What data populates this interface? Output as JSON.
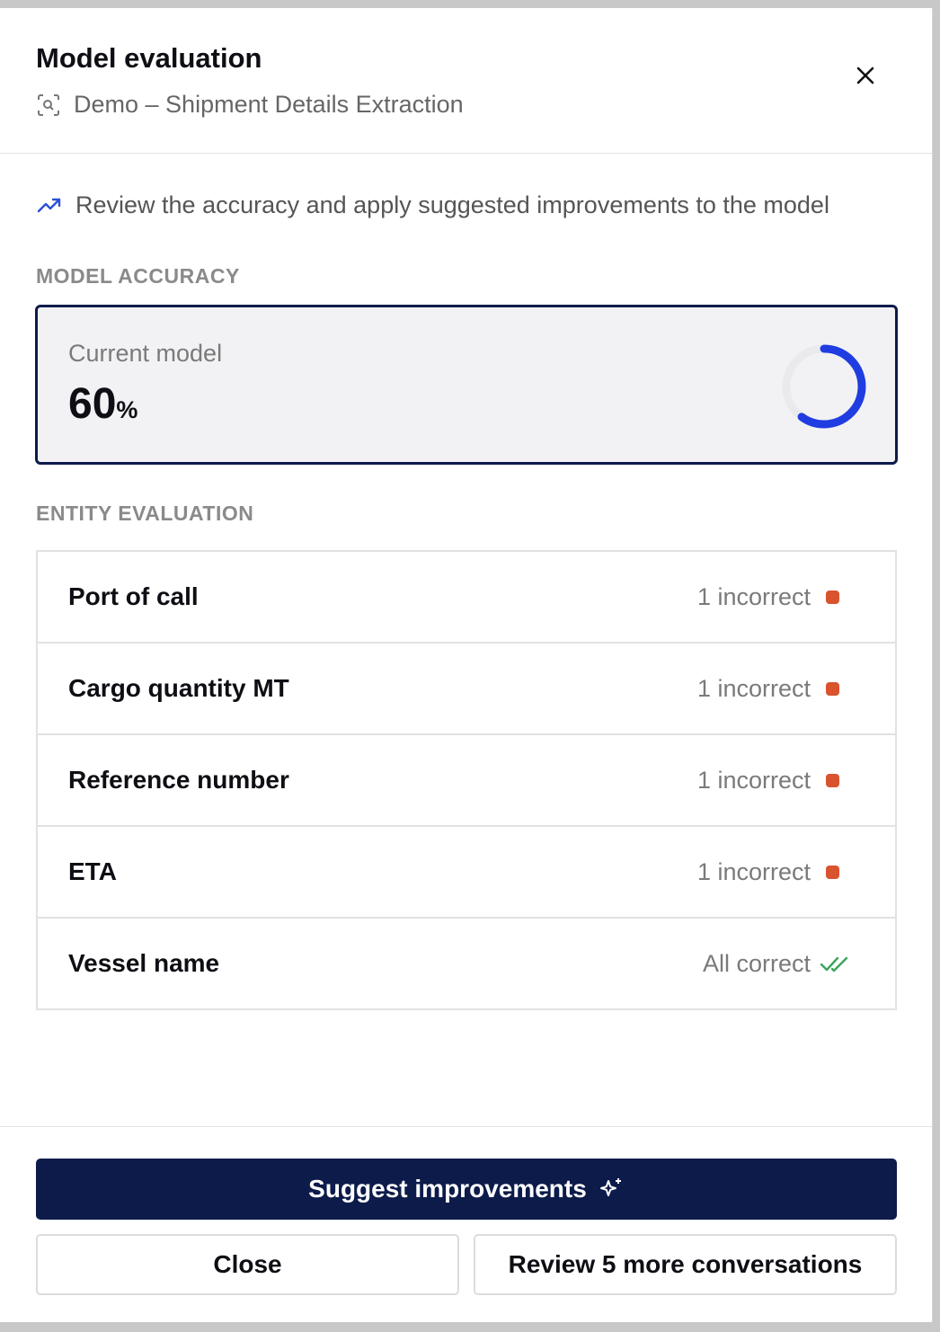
{
  "header": {
    "title": "Model evaluation",
    "subtitle": "Demo – Shipment Details Extraction",
    "subtitle_icon": "scan-search-icon",
    "close_icon": "close-icon"
  },
  "tip": {
    "icon": "trending-up-icon",
    "text": "Review the accuracy and apply suggested improvements to the model"
  },
  "accuracy": {
    "section_label": "MODEL ACCURACY",
    "caption": "Current model",
    "value": "60",
    "unit": "%",
    "fraction": 0.6
  },
  "entities": {
    "section_label": "ENTITY EVALUATION",
    "rows": [
      {
        "name": "Port of call",
        "status": "1 incorrect",
        "state": "incorrect"
      },
      {
        "name": "Cargo quantity MT",
        "status": "1 incorrect",
        "state": "incorrect"
      },
      {
        "name": "Reference number",
        "status": "1 incorrect",
        "state": "incorrect"
      },
      {
        "name": "ETA",
        "status": "1 incorrect",
        "state": "incorrect"
      },
      {
        "name": "Vessel name",
        "status": "All correct",
        "state": "correct"
      }
    ]
  },
  "footer": {
    "suggest_label": "Suggest improvements",
    "suggest_icon": "sparkles-icon",
    "close_label": "Close",
    "review_label": "Review 5 more conversations"
  },
  "colors": {
    "primary": "#0d1b4b",
    "accent_ring": "#1f3de0",
    "incorrect": "#d9532f",
    "correct": "#3aa55a",
    "tip_icon": "#2b4fd6"
  }
}
